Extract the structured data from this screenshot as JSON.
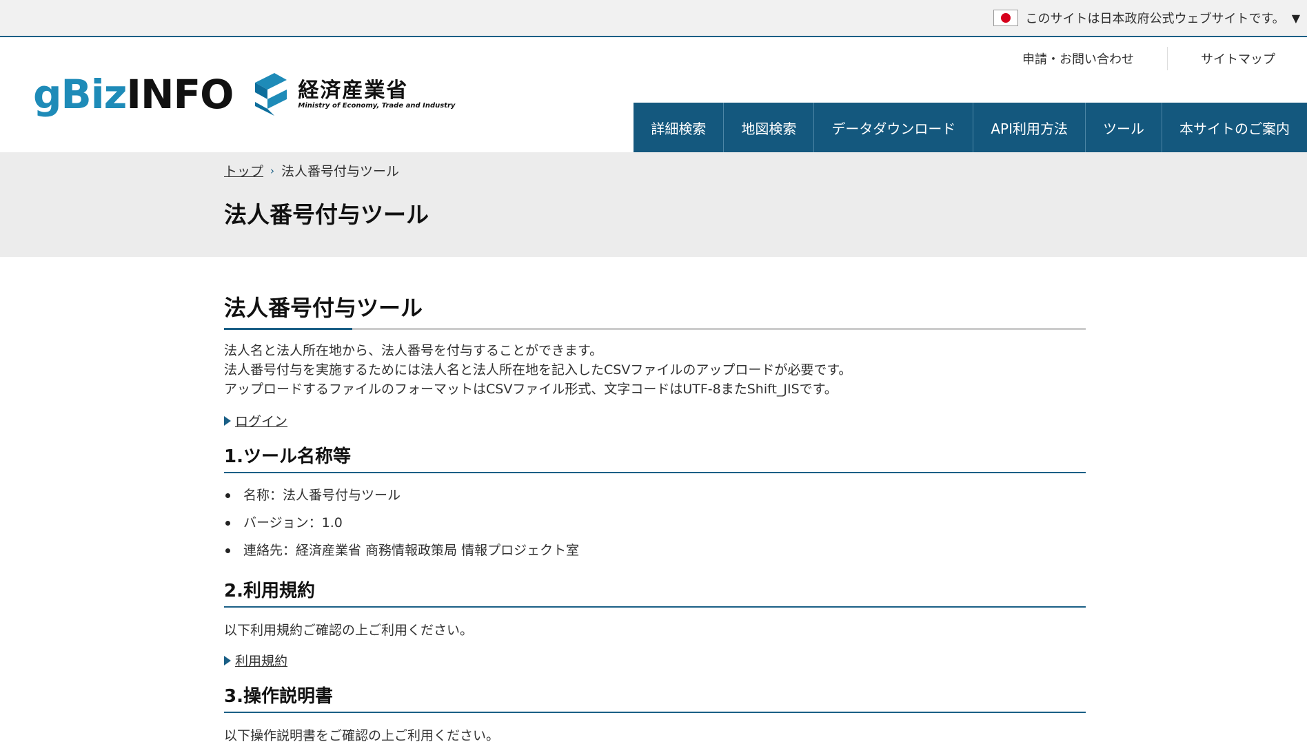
{
  "gov_banner": {
    "text": "このサイトは日本政府公式ウェブサイトです。",
    "toggle": "▼"
  },
  "logo": {
    "gbiz_prefix": "gBiz",
    "gbiz_suffix": "INFO",
    "meti_jp": "経済産業省",
    "meti_en": "Ministry of Economy, Trade and Industry"
  },
  "util_links": [
    "申請・お問い合わせ",
    "サイトマップ"
  ],
  "nav": [
    "詳細検索",
    "地図検索",
    "データダウンロード",
    "API利用方法",
    "ツール",
    "本サイトのご案内"
  ],
  "breadcrumb": {
    "home": "トップ",
    "separator": "›",
    "current": "法人番号付与ツール"
  },
  "page_title": "法人番号付与ツール",
  "content": {
    "heading": "法人番号付与ツール",
    "intro": [
      "法人名と法人所在地から、法人番号を付与することができます。",
      "法人番号付与を実施するためには法人名と法人所在地を記入したCSVファイルのアップロードが必要です。",
      "アップロードするファイルのフォーマットはCSVファイル形式、文字コードはUTF-8またShift_JISです。"
    ],
    "login_link": "ログイン",
    "section1": {
      "title": "1.ツール名称等",
      "items": [
        "名称：法人番号付与ツール",
        "バージョン：1.0",
        "連絡先：経済産業省 商務情報政策局 情報プロジェクト室"
      ]
    },
    "section2": {
      "title": "2.利用規約",
      "text": "以下利用規約ご確認の上ご利用ください。",
      "link": "利用規約"
    },
    "section3": {
      "title": "3.操作説明書",
      "text": "以下操作説明書をご確認の上ご利用ください。"
    }
  },
  "colors": {
    "nav_bg": "#14587e",
    "accent": "#1a5f86",
    "band_bg": "#ececec",
    "logo_blue": "#1e8bb8"
  }
}
